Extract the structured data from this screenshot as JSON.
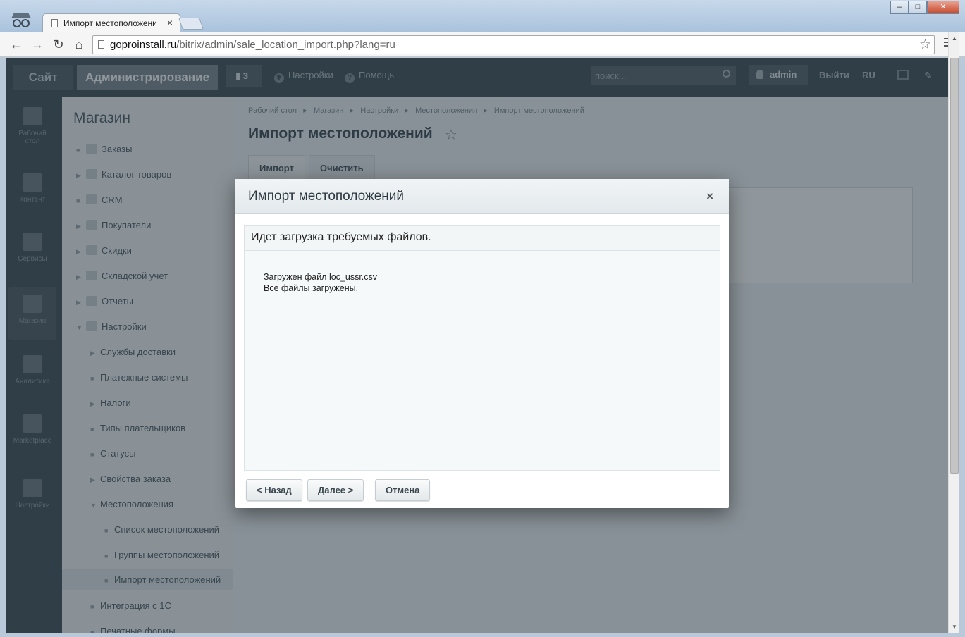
{
  "browser": {
    "tab_title": "Импорт местоположени",
    "tab_close": "×",
    "url_domain": "goproinstall.ru",
    "url_path": "/bitrix/admin/sale_location_import.php?lang=ru",
    "window_buttons": {
      "minimize": "‒",
      "maximize": "□",
      "close": "✕"
    }
  },
  "admin_header": {
    "site_button": "Сайт",
    "admin_button": "Администрирование",
    "notifications_count": "3",
    "settings": "Настройки",
    "help": "Помощь",
    "search_placeholder": "поиск...",
    "user": "admin",
    "logout": "Выйти",
    "language": "RU"
  },
  "rail": {
    "items": [
      {
        "label_1": "Рабочий",
        "label_2": "стол"
      },
      {
        "label_1": "Контент"
      },
      {
        "label_1": "Сервисы"
      },
      {
        "label_1": "Магазин"
      },
      {
        "label_1": "Аналитика"
      },
      {
        "label_1": "Marketplace"
      },
      {
        "label_1": "Настройки"
      }
    ]
  },
  "menu": {
    "title": "Магазин",
    "items": [
      "Заказы",
      "Каталог товаров",
      "CRM",
      "Покупатели",
      "Скидки",
      "Складской учет",
      "Отчеты",
      "Настройки",
      "Службы доставки",
      "Платежные системы",
      "Налоги",
      "Типы плательщиков",
      "Статусы",
      "Свойства заказа",
      "Местоположения",
      "Список местоположений",
      "Группы местоположений",
      "Импорт местоположений",
      "Интеграция с 1С",
      "Печатные формы"
    ]
  },
  "content": {
    "breadcrumb": [
      "Рабочий стол",
      "Магазин",
      "Настройки",
      "Местоположения",
      "Импорт местоположений"
    ],
    "breadcrumb_sep": "▸",
    "title": "Импорт местоположений",
    "tabs": [
      "Импорт",
      "Очистить"
    ]
  },
  "dialog": {
    "title": "Импорт местоположений",
    "close": "×",
    "subtitle": "Идет загрузка требуемых файлов.",
    "line_1": "Загружен файл loc_ussr.csv",
    "line_2": "Все файлы загружены.",
    "back_button": "< Назад",
    "next_button": "Далее >",
    "cancel_button": "Отмена"
  }
}
